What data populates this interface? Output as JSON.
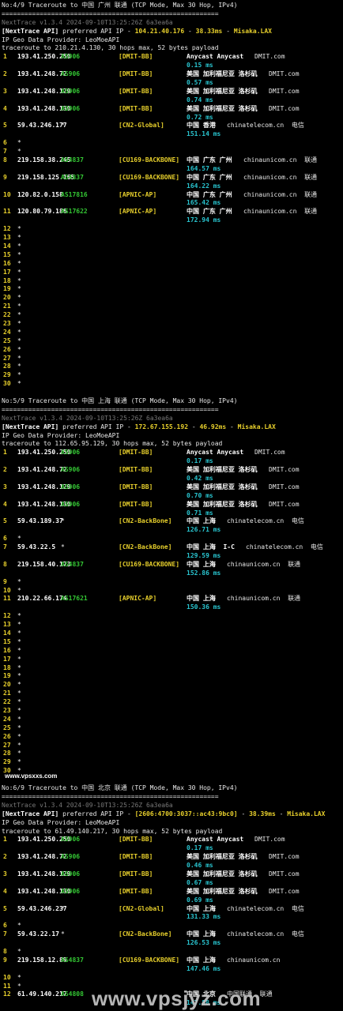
{
  "blocks": [
    {
      "header": "No:4/9 Traceroute to 中国 广州 联通 (TCP Mode, Max 30 Hop, IPv4)",
      "rule": "=========================================================",
      "version": "NextTrace v1.3.4 2024-09-10T13:25:26Z 6a3ea6a",
      "api_prefix": "[NextTrace API]",
      "api_text": " preferred API IP - ",
      "api_ip": "104.21.40.176",
      "api_sep": " - ",
      "api_ms": "38.33ms",
      "api_node": "Misaka.LAX",
      "geo": "IP Geo Data Provider: LeoMoeAPI",
      "target": "traceroute to 210.21.4.130, 30 hops max, 52 bytes payload",
      "hops": [
        {
          "n": "1",
          "ip": "193.41.250.250",
          "asn": "AS906",
          "tag": "[DMIT-BB]",
          "geo": "Anycast Anycast",
          "isp": "DMIT.com",
          "ms": "0.15 ms"
        },
        {
          "n": "2",
          "ip": "193.41.248.72",
          "asn": "AS906",
          "tag": "[DMIT-BB]",
          "geo": "美国 加利福尼亚 洛杉矶",
          "isp": "DMIT.com",
          "ms": "0.57 ms"
        },
        {
          "n": "3",
          "ip": "193.41.248.129",
          "asn": "AS906",
          "tag": "[DMIT-BB]",
          "geo": "美国 加利福尼亚 洛杉矶",
          "isp": "DMIT.com",
          "ms": "0.74 ms"
        },
        {
          "n": "4",
          "ip": "193.41.248.130",
          "asn": "AS906",
          "tag": "[DMIT-BB]",
          "geo": "美国 加利福尼亚 洛杉矶",
          "isp": "DMIT.com",
          "ms": "0.72 ms"
        },
        {
          "n": "5",
          "ip": "59.43.246.177",
          "asn": "*",
          "tag": "[CN2-Global]",
          "geo": "中国 香港",
          "isp": "chinatelecom.cn  电信",
          "ms": "151.14 ms"
        },
        {
          "n": "6",
          "star": true
        },
        {
          "n": "7",
          "star": true
        },
        {
          "n": "8",
          "ip": "219.158.38.245",
          "asn": "AS4837",
          "tag": "[CU169-BACKBONE]",
          "geo": "中国 广东 广州",
          "isp": "chinaunicom.cn  联通",
          "ms": "164.57 ms"
        },
        {
          "n": "9",
          "ip": "219.158.125.165",
          "asn": "AS4837",
          "tag": "[CU169-BACKBONE]",
          "geo": "中国 广东 广州",
          "isp": "chinaunicom.cn  联通",
          "ms": "164.22 ms"
        },
        {
          "n": "10",
          "ip": "120.82.0.158",
          "asn": "AS17816",
          "tag": "[APNIC-AP]",
          "geo": "中国 广东 广州",
          "isp": "chinaunicom.cn  联通",
          "ms": "165.42 ms"
        },
        {
          "n": "11",
          "ip": "120.80.79.186",
          "asn": "AS17622",
          "tag": "[APNIC-AP]",
          "geo": "中国 广东 广州",
          "isp": "chinaunicom.cn  联通",
          "ms": "172.94 ms"
        },
        {
          "n": "12",
          "star": true
        },
        {
          "n": "13",
          "star": true
        },
        {
          "n": "14",
          "star": true
        },
        {
          "n": "15",
          "star": true
        },
        {
          "n": "16",
          "star": true
        },
        {
          "n": "17",
          "star": true
        },
        {
          "n": "18",
          "star": true
        },
        {
          "n": "19",
          "star": true
        },
        {
          "n": "20",
          "star": true
        },
        {
          "n": "21",
          "star": true
        },
        {
          "n": "22",
          "star": true
        },
        {
          "n": "23",
          "star": true
        },
        {
          "n": "24",
          "star": true
        },
        {
          "n": "25",
          "star": true
        },
        {
          "n": "26",
          "star": true
        },
        {
          "n": "27",
          "star": true
        },
        {
          "n": "28",
          "star": true
        },
        {
          "n": "29",
          "star": true
        },
        {
          "n": "30",
          "star": true
        }
      ]
    },
    {
      "header": "No:5/9 Traceroute to 中国 上海 联通 (TCP Mode, Max 30 Hop, IPv4)",
      "rule": "=========================================================",
      "version": "NextTrace v1.3.4 2024-09-10T13:25:26Z 6a3ea6a",
      "api_prefix": "[NextTrace API]",
      "api_text": " preferred API IP - ",
      "api_ip": "172.67.155.192",
      "api_sep": " - ",
      "api_ms": "46.92ms",
      "api_node": "Misaka.LAX",
      "geo": "IP Geo Data Provider: LeoMoeAPI",
      "target": "traceroute to 112.65.95.129, 30 hops max, 52 bytes payload",
      "hops": [
        {
          "n": "1",
          "ip": "193.41.250.250",
          "asn": "AS906",
          "tag": "[DMIT-BB]",
          "geo": "Anycast Anycast",
          "isp": "DMIT.com",
          "ms": "0.17 ms"
        },
        {
          "n": "2",
          "ip": "193.41.248.72",
          "asn": "AS906",
          "tag": "[DMIT-BB]",
          "geo": "美国 加利福尼亚 洛杉矶",
          "isp": "DMIT.com",
          "ms": "0.42 ms"
        },
        {
          "n": "3",
          "ip": "193.41.248.129",
          "asn": "AS906",
          "tag": "[DMIT-BB]",
          "geo": "美国 加利福尼亚 洛杉矶",
          "isp": "DMIT.com",
          "ms": "0.70 ms"
        },
        {
          "n": "4",
          "ip": "193.41.248.130",
          "asn": "AS906",
          "tag": "[DMIT-BB]",
          "geo": "美国 加利福尼亚 洛杉矶",
          "isp": "DMIT.com",
          "ms": "0.71 ms"
        },
        {
          "n": "5",
          "ip": "59.43.189.37",
          "asn": "*",
          "tag": "[CN2-BackBone]",
          "geo": "中国 上海",
          "isp": "chinatelecom.cn  电信",
          "ms": "126.71 ms"
        },
        {
          "n": "6",
          "star": true
        },
        {
          "n": "7",
          "ip": "59.43.22.5",
          "asn": "*",
          "tag": "[CN2-BackBone]",
          "geo": "中国 上海  I-C",
          "isp": "chinatelecom.cn  电信",
          "ms": "129.59 ms"
        },
        {
          "n": "8",
          "ip": "219.158.40.173",
          "asn": "AS4837",
          "tag": "[CU169-BACKBONE]",
          "geo": "中国 上海",
          "isp": "chinaunicom.cn  联通",
          "ms": "152.86 ms"
        },
        {
          "n": "9",
          "star": true
        },
        {
          "n": "10",
          "star": true
        },
        {
          "n": "11",
          "ip": "210.22.66.174",
          "asn": "AS17621",
          "tag": "[APNIC-AP]",
          "geo": "中国 上海",
          "isp": "chinaunicom.cn  联通",
          "ms": "150.36 ms"
        },
        {
          "n": "12",
          "star": true
        },
        {
          "n": "13",
          "star": true
        },
        {
          "n": "14",
          "star": true
        },
        {
          "n": "15",
          "star": true
        },
        {
          "n": "16",
          "star": true
        },
        {
          "n": "17",
          "star": true
        },
        {
          "n": "18",
          "star": true
        },
        {
          "n": "19",
          "star": true
        },
        {
          "n": "20",
          "star": true
        },
        {
          "n": "21",
          "star": true
        },
        {
          "n": "22",
          "star": true
        },
        {
          "n": "23",
          "star": true
        },
        {
          "n": "24",
          "star": true
        },
        {
          "n": "25",
          "star": true
        },
        {
          "n": "26",
          "star": true
        },
        {
          "n": "27",
          "star": true
        },
        {
          "n": "28",
          "star": true
        },
        {
          "n": "29",
          "star": true
        },
        {
          "n": "30",
          "star": true
        }
      ]
    },
    {
      "header": "No:6/9 Traceroute to 中国 北京 联通 (TCP Mode, Max 30 Hop, IPv4)",
      "rule": "=========================================================",
      "version": "NextTrace v1.3.4 2024-09-10T13:25:26Z 6a3ea6a",
      "api_prefix": "[NextTrace API]",
      "api_text": " preferred API IP - ",
      "api_ip": "[2606:4700:3037::ac43:9bc0]",
      "api_sep": " - ",
      "api_ms": "38.39ms",
      "api_node": "Misaka.LAX",
      "geo": "IP Geo Data Provider: LeoMoeAPI",
      "target": "traceroute to 61.49.140.217, 30 hops max, 52 bytes payload",
      "hops": [
        {
          "n": "1",
          "ip": "193.41.250.250",
          "asn": "AS906",
          "tag": "[DMIT-BB]",
          "geo": "Anycast Anycast",
          "isp": "DMIT.com",
          "ms": "0.17 ms"
        },
        {
          "n": "2",
          "ip": "193.41.248.72",
          "asn": "AS906",
          "tag": "[DMIT-BB]",
          "geo": "美国 加利福尼亚 洛杉矶",
          "isp": "DMIT.com",
          "ms": "0.46 ms"
        },
        {
          "n": "3",
          "ip": "193.41.248.129",
          "asn": "AS906",
          "tag": "[DMIT-BB]",
          "geo": "美国 加利福尼亚 洛杉矶",
          "isp": "DMIT.com",
          "ms": "0.67 ms"
        },
        {
          "n": "4",
          "ip": "193.41.248.130",
          "asn": "AS906",
          "tag": "[DMIT-BB]",
          "geo": "美国 加利福尼亚 洛杉矶",
          "isp": "DMIT.com",
          "ms": "0.69 ms"
        },
        {
          "n": "5",
          "ip": "59.43.246.237",
          "asn": "*",
          "tag": "[CN2-Global]",
          "geo": "中国 上海",
          "isp": "chinatelecom.cn  电信",
          "ms": "131.33 ms"
        },
        {
          "n": "6",
          "star": true
        },
        {
          "n": "7",
          "ip": "59.43.22.17",
          "asn": "*",
          "tag": "[CN2-BackBone]",
          "geo": "中国 上海",
          "isp": "chinatelecom.cn  电信",
          "ms": "126.53 ms"
        },
        {
          "n": "8",
          "star": true
        },
        {
          "n": "9",
          "ip": "219.158.12.89",
          "asn": "AS4837",
          "tag": "[CU169-BACKBONE]",
          "geo": "中国 上海",
          "isp": "chinaunicom.cn",
          "ms": "147.46 ms"
        },
        {
          "n": "10",
          "star": true
        },
        {
          "n": "11",
          "star": true
        },
        {
          "n": "12",
          "ip": "61.49.140.217",
          "asn": "AS4808",
          "tag": "",
          "geo": "中国 北京",
          "isp": "中国联通  联通",
          "ms": "147.88 ms"
        }
      ]
    }
  ],
  "watermark_small": "www.vpsxxs.com",
  "watermark_large": "www.vpsjyz.com"
}
